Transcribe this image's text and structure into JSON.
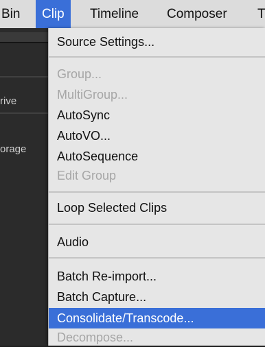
{
  "menubar": {
    "items": [
      {
        "label": "Bin"
      },
      {
        "label": "Clip"
      },
      {
        "label": "Timeline"
      },
      {
        "label": "Composer"
      },
      {
        "label": "T"
      }
    ]
  },
  "background": {
    "labels": [
      "rive",
      "orage"
    ]
  },
  "clip_menu": {
    "items": [
      {
        "label": "Source Settings...",
        "enabled": true
      },
      {
        "label": "Group...",
        "enabled": false
      },
      {
        "label": "MultiGroup...",
        "enabled": false
      },
      {
        "label": "AutoSync",
        "enabled": true
      },
      {
        "label": "AutoVO...",
        "enabled": true
      },
      {
        "label": "AutoSequence",
        "enabled": true
      },
      {
        "label": "Edit Group",
        "enabled": false
      },
      {
        "label": "Loop Selected Clips",
        "enabled": true
      },
      {
        "label": "Audio",
        "enabled": true
      },
      {
        "label": "Batch Re-import...",
        "enabled": true
      },
      {
        "label": "Batch Capture...",
        "enabled": true
      },
      {
        "label": "Consolidate/Transcode...",
        "enabled": true,
        "highlighted": true
      },
      {
        "label": "Decompose...",
        "enabled": false
      }
    ]
  },
  "colors": {
    "highlight": "#3a6fd8",
    "menu_bg": "#e6e6e6",
    "disabled_text": "#a6a6a6"
  }
}
